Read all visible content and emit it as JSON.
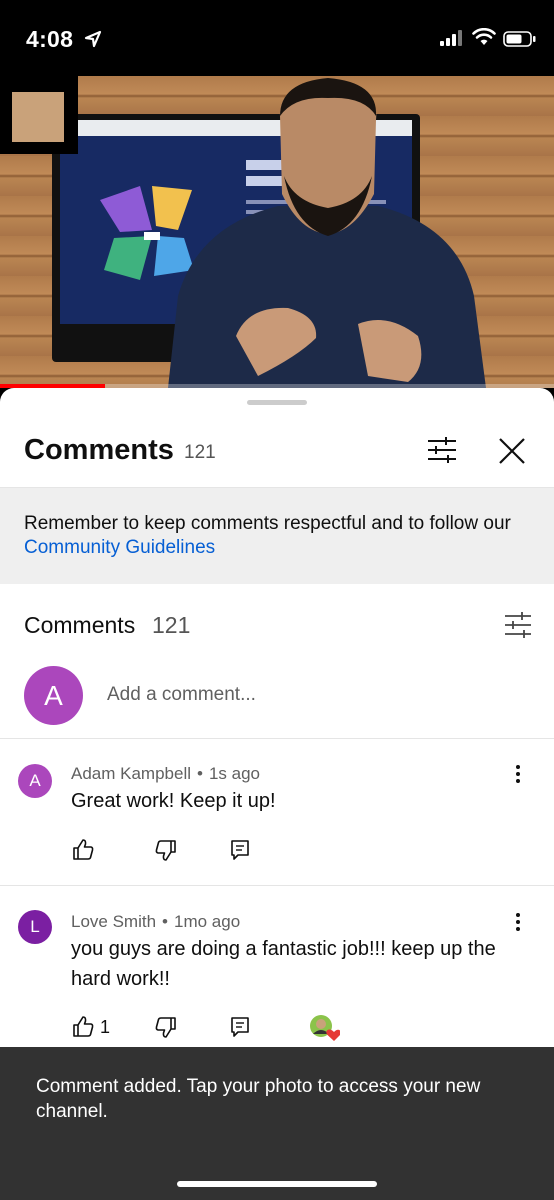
{
  "status_bar": {
    "time": "4:08"
  },
  "video": {
    "progress": 0.19
  },
  "comments_sheet": {
    "title": "Comments",
    "count": "121",
    "notice": {
      "text": "Remember to keep comments respectful and to follow our ",
      "link": "Community Guidelines"
    },
    "section_title": "Comments",
    "section_count": "121",
    "add_comment": {
      "avatar_letter": "A",
      "placeholder": "Add a comment..."
    },
    "comments": [
      {
        "avatar_letter": "A",
        "avatar_color": "#ab47bc",
        "author": "Adam Kampbell",
        "time": "1s ago",
        "text": "Great work! Keep it up!",
        "likes": ""
      },
      {
        "avatar_letter": "L",
        "avatar_color": "#7b1fa2",
        "author": "Love Smith",
        "time": "1mo ago",
        "text": "you guys are doing a fantastic job!!! keep up the hard work!!",
        "likes": "1"
      }
    ]
  },
  "snackbar": {
    "text": "Comment added. Tap your photo to access your new channel."
  },
  "colors": {
    "accent_link": "#065fd4",
    "progress": "#ff0000",
    "snackbar_bg": "#323232"
  }
}
